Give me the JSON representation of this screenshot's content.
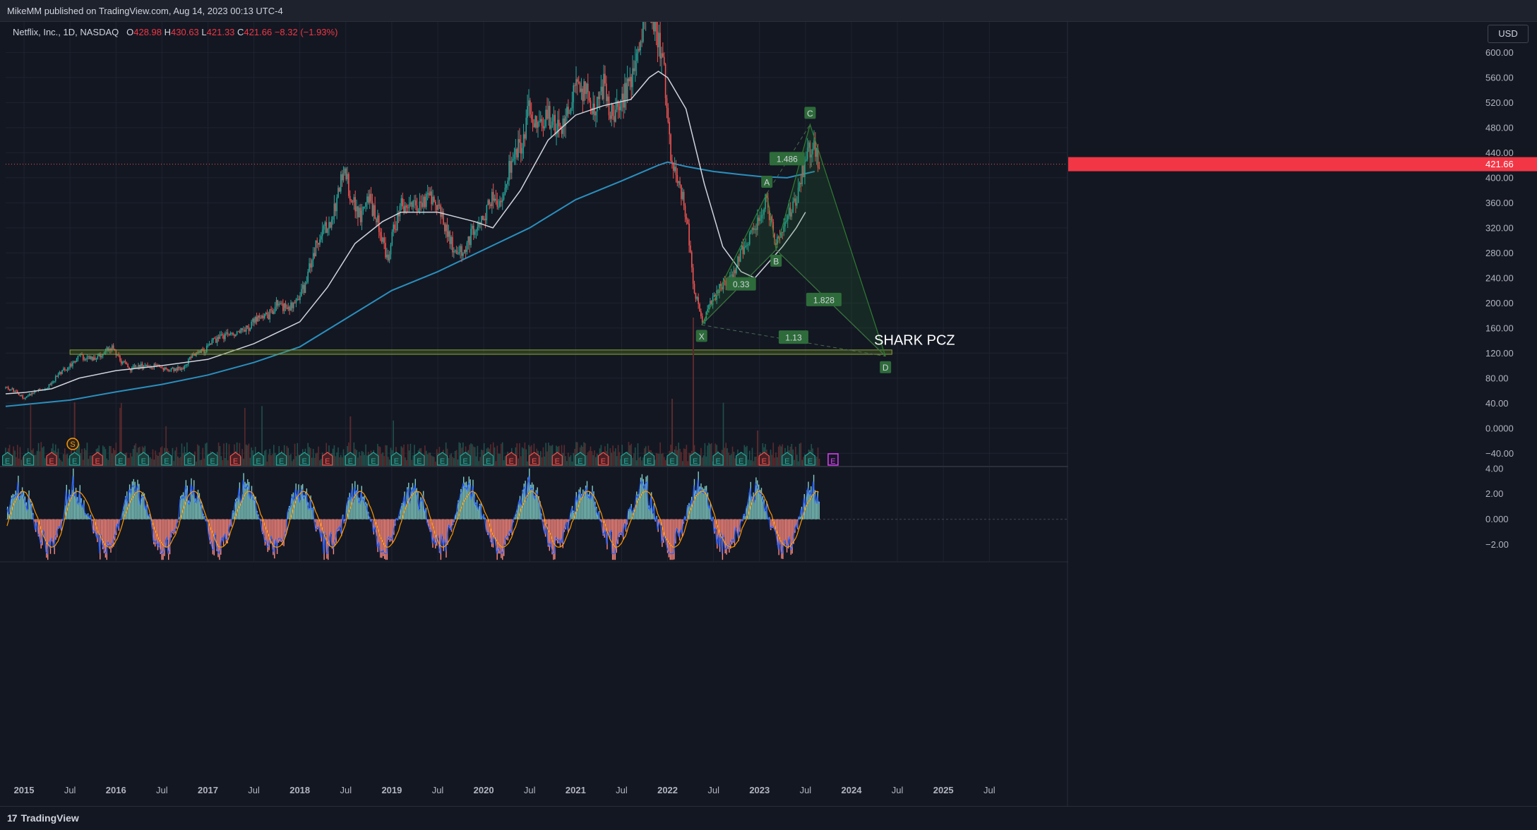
{
  "header": {
    "published": "MikeMM published on TradingView.com, Aug 14, 2023 00:13 UTC-4"
  },
  "legend": {
    "symbol": "Netflix, Inc., 1D, NASDAQ",
    "o_label": "O",
    "o_value": "428.98",
    "h_label": "H",
    "h_value": "430.63",
    "l_label": "L",
    "l_value": "421.33",
    "c_label": "C",
    "c_value": "421.66",
    "change": "−8.32 (−1.93%)"
  },
  "currency_button": "USD",
  "footer": {
    "brand": "TradingView",
    "brand_mark": "17"
  },
  "colors": {
    "background": "#131722",
    "candle_up": "#26a69a",
    "candle_down": "#ef5350",
    "ma_fast": "#d1d4dc",
    "ma_slow": "#2a8fbd",
    "pattern": "#2e7d32",
    "zone": "#6b8e23",
    "osc_pos": "#80cbc4",
    "osc_neg": "#ff8a80",
    "osc_line1": "#2962ff",
    "osc_line2": "#ff9800"
  },
  "chart_data": {
    "type": "candlestick",
    "title": "",
    "yaxis_ticks": [
      "600.00",
      "560.00",
      "520.00",
      "480.00",
      "440.00",
      "400.00",
      "360.00",
      "320.00",
      "280.00",
      "240.00",
      "200.00",
      "160.00",
      "120.00",
      "80.00",
      "40.00",
      "0.0000",
      "−40.00"
    ],
    "yaxis_values": [
      600,
      560,
      520,
      480,
      440,
      400,
      360,
      320,
      280,
      240,
      200,
      160,
      120,
      80,
      40,
      0,
      -40
    ],
    "ylim": [
      -60,
      650
    ],
    "last_price": {
      "value": 421.66,
      "label": "421.66"
    },
    "xaxis_ticks": [
      "2015",
      "Jul",
      "2016",
      "Jul",
      "2017",
      "Jul",
      "2018",
      "Jul",
      "2019",
      "Jul",
      "2020",
      "Jul",
      "2021",
      "Jul",
      "2022",
      "Jul",
      "2023",
      "Jul",
      "2024",
      "Jul",
      "2025",
      "Jul"
    ],
    "xaxis_values": [
      2015.0,
      2015.5,
      2016.0,
      2016.5,
      2017.0,
      2017.5,
      2018.0,
      2018.5,
      2019.0,
      2019.5,
      2020.0,
      2020.5,
      2021.0,
      2021.5,
      2022.0,
      2022.5,
      2023.0,
      2023.5,
      2024.0,
      2024.5,
      2025.0,
      2025.5
    ],
    "xlim": [
      2014.8,
      2026.35
    ],
    "price_path": [
      [
        2014.8,
        65
      ],
      [
        2014.9,
        60
      ],
      [
        2015.0,
        48
      ],
      [
        2015.1,
        58
      ],
      [
        2015.25,
        65
      ],
      [
        2015.4,
        90
      ],
      [
        2015.5,
        100
      ],
      [
        2015.6,
        115
      ],
      [
        2015.75,
        110
      ],
      [
        2015.85,
        118
      ],
      [
        2015.95,
        130
      ],
      [
        2016.05,
        108
      ],
      [
        2016.15,
        95
      ],
      [
        2016.25,
        100
      ],
      [
        2016.35,
        98
      ],
      [
        2016.45,
        100
      ],
      [
        2016.55,
        92
      ],
      [
        2016.65,
        95
      ],
      [
        2016.75,
        98
      ],
      [
        2016.85,
        120
      ],
      [
        2016.95,
        122
      ],
      [
        2017.05,
        140
      ],
      [
        2017.15,
        145
      ],
      [
        2017.25,
        150
      ],
      [
        2017.35,
        158
      ],
      [
        2017.45,
        162
      ],
      [
        2017.55,
        180
      ],
      [
        2017.65,
        178
      ],
      [
        2017.75,
        198
      ],
      [
        2017.85,
        192
      ],
      [
        2017.95,
        200
      ],
      [
        2018.05,
        225
      ],
      [
        2018.15,
        280
      ],
      [
        2018.25,
        320
      ],
      [
        2018.35,
        330
      ],
      [
        2018.45,
        395
      ],
      [
        2018.5,
        410
      ],
      [
        2018.55,
        370
      ],
      [
        2018.65,
        340
      ],
      [
        2018.75,
        365
      ],
      [
        2018.85,
        330
      ],
      [
        2018.95,
        268
      ],
      [
        2019.0,
        305
      ],
      [
        2019.1,
        355
      ],
      [
        2019.2,
        360
      ],
      [
        2019.3,
        360
      ],
      [
        2019.4,
        370
      ],
      [
        2019.5,
        355
      ],
      [
        2019.6,
        310
      ],
      [
        2019.7,
        278
      ],
      [
        2019.8,
        290
      ],
      [
        2019.9,
        320
      ],
      [
        2020.0,
        332
      ],
      [
        2020.1,
        375
      ],
      [
        2020.2,
        360
      ],
      [
        2020.3,
        430
      ],
      [
        2020.4,
        450
      ],
      [
        2020.5,
        510
      ],
      [
        2020.6,
        490
      ],
      [
        2020.7,
        500
      ],
      [
        2020.8,
        480
      ],
      [
        2020.9,
        495
      ],
      [
        2021.0,
        540
      ],
      [
        2021.1,
        540
      ],
      [
        2021.2,
        510
      ],
      [
        2021.3,
        550
      ],
      [
        2021.4,
        495
      ],
      [
        2021.5,
        525
      ],
      [
        2021.6,
        550
      ],
      [
        2021.7,
        625
      ],
      [
        2021.78,
        680
      ],
      [
        2021.85,
        640
      ],
      [
        2021.95,
        600
      ],
      [
        2022.0,
        505
      ],
      [
        2022.05,
        410
      ],
      [
        2022.12,
        390
      ],
      [
        2022.2,
        345
      ],
      [
        2022.28,
        230
      ],
      [
        2022.35,
        185
      ],
      [
        2022.38,
        170
      ],
      [
        2022.45,
        195
      ],
      [
        2022.55,
        220
      ],
      [
        2022.65,
        235
      ],
      [
        2022.75,
        260
      ],
      [
        2022.85,
        300
      ],
      [
        2022.95,
        320
      ],
      [
        2023.0,
        340
      ],
      [
        2023.08,
        365
      ],
      [
        2023.15,
        310
      ],
      [
        2023.22,
        295
      ],
      [
        2023.3,
        335
      ],
      [
        2023.4,
        360
      ],
      [
        2023.5,
        430
      ],
      [
        2023.55,
        450
      ],
      [
        2023.62,
        440
      ],
      [
        2023.65,
        421.66
      ]
    ],
    "ma_fast": [
      [
        2014.8,
        55
      ],
      [
        2015.0,
        57
      ],
      [
        2015.3,
        63
      ],
      [
        2015.6,
        80
      ],
      [
        2016.0,
        92
      ],
      [
        2016.5,
        100
      ],
      [
        2017.0,
        110
      ],
      [
        2017.5,
        135
      ],
      [
        2018.0,
        170
      ],
      [
        2018.3,
        225
      ],
      [
        2018.6,
        295
      ],
      [
        2018.9,
        330
      ],
      [
        2019.1,
        345
      ],
      [
        2019.5,
        345
      ],
      [
        2019.9,
        330
      ],
      [
        2020.1,
        320
      ],
      [
        2020.4,
        380
      ],
      [
        2020.7,
        460
      ],
      [
        2021.0,
        500
      ],
      [
        2021.3,
        515
      ],
      [
        2021.6,
        525
      ],
      [
        2021.8,
        560
      ],
      [
        2021.9,
        570
      ],
      [
        2022.0,
        560
      ],
      [
        2022.2,
        510
      ],
      [
        2022.4,
        390
      ],
      [
        2022.6,
        290
      ],
      [
        2022.8,
        250
      ],
      [
        2022.95,
        240
      ],
      [
        2023.1,
        265
      ],
      [
        2023.25,
        290
      ],
      [
        2023.4,
        320
      ],
      [
        2023.5,
        345
      ]
    ],
    "ma_slow": [
      [
        2014.8,
        35
      ],
      [
        2015.5,
        45
      ],
      [
        2016.0,
        58
      ],
      [
        2016.5,
        70
      ],
      [
        2017.0,
        85
      ],
      [
        2017.5,
        105
      ],
      [
        2018.0,
        130
      ],
      [
        2018.5,
        175
      ],
      [
        2019.0,
        220
      ],
      [
        2019.5,
        250
      ],
      [
        2020.0,
        285
      ],
      [
        2020.5,
        320
      ],
      [
        2021.0,
        365
      ],
      [
        2021.5,
        395
      ],
      [
        2021.9,
        420
      ],
      [
        2022.0,
        425
      ],
      [
        2022.2,
        418
      ],
      [
        2022.5,
        410
      ],
      [
        2022.8,
        405
      ],
      [
        2023.0,
        402
      ],
      [
        2023.3,
        400
      ],
      [
        2023.6,
        410
      ]
    ],
    "pattern": {
      "name": "SHARK PCZ",
      "points": [
        {
          "label": "X",
          "x": 2022.37,
          "y": 165
        },
        {
          "label": "A",
          "x": 2023.08,
          "y": 375
        },
        {
          "label": "B",
          "x": 2023.18,
          "y": 285
        },
        {
          "label": "C",
          "x": 2023.55,
          "y": 485
        },
        {
          "label": "D",
          "x": 2024.37,
          "y": 115
        }
      ],
      "ratios": [
        {
          "label": "1.486",
          "x": 2023.3,
          "y": 430
        },
        {
          "label": "0.33",
          "x": 2022.8,
          "y": 230
        },
        {
          "label": "1.828",
          "x": 2023.7,
          "y": 205
        },
        {
          "label": "1.13",
          "x": 2023.37,
          "y": 145
        }
      ],
      "zone": {
        "x0": 2015.5,
        "x1": 2024.44,
        "y0": 118,
        "y1": 125
      }
    },
    "events": {
      "earnings_label": "E",
      "split_label": "S",
      "split_x": 2015.53,
      "earnings_x": [
        2014.82,
        2015.05,
        2015.3,
        2015.55,
        2015.8,
        2016.05,
        2016.3,
        2016.55,
        2016.8,
        2017.05,
        2017.3,
        2017.55,
        2017.8,
        2018.05,
        2018.3,
        2018.55,
        2018.8,
        2019.05,
        2019.3,
        2019.55,
        2019.8,
        2020.05,
        2020.3,
        2020.55,
        2020.8,
        2021.05,
        2021.3,
        2021.55,
        2021.8,
        2022.05,
        2022.3,
        2022.55,
        2022.8,
        2023.05,
        2023.3,
        2023.55,
        2023.8
      ],
      "earnings_type": [
        "u",
        "u",
        "d",
        "u",
        "d",
        "u",
        "u",
        "u",
        "u",
        "u",
        "d",
        "u",
        "u",
        "u",
        "d",
        "u",
        "u",
        "u",
        "u",
        "u",
        "u",
        "u",
        "d",
        "d",
        "d",
        "u",
        "d",
        "u",
        "u",
        "u",
        "u",
        "u",
        "u",
        "d",
        "u",
        "u",
        "f"
      ]
    },
    "oscillator": {
      "yaxis_ticks": [
        "4.00",
        "2.00",
        "0.000",
        "−2.00"
      ],
      "yaxis_values": [
        4,
        2,
        0,
        -2
      ],
      "ylim": [
        -3.3,
        4.1
      ]
    }
  }
}
